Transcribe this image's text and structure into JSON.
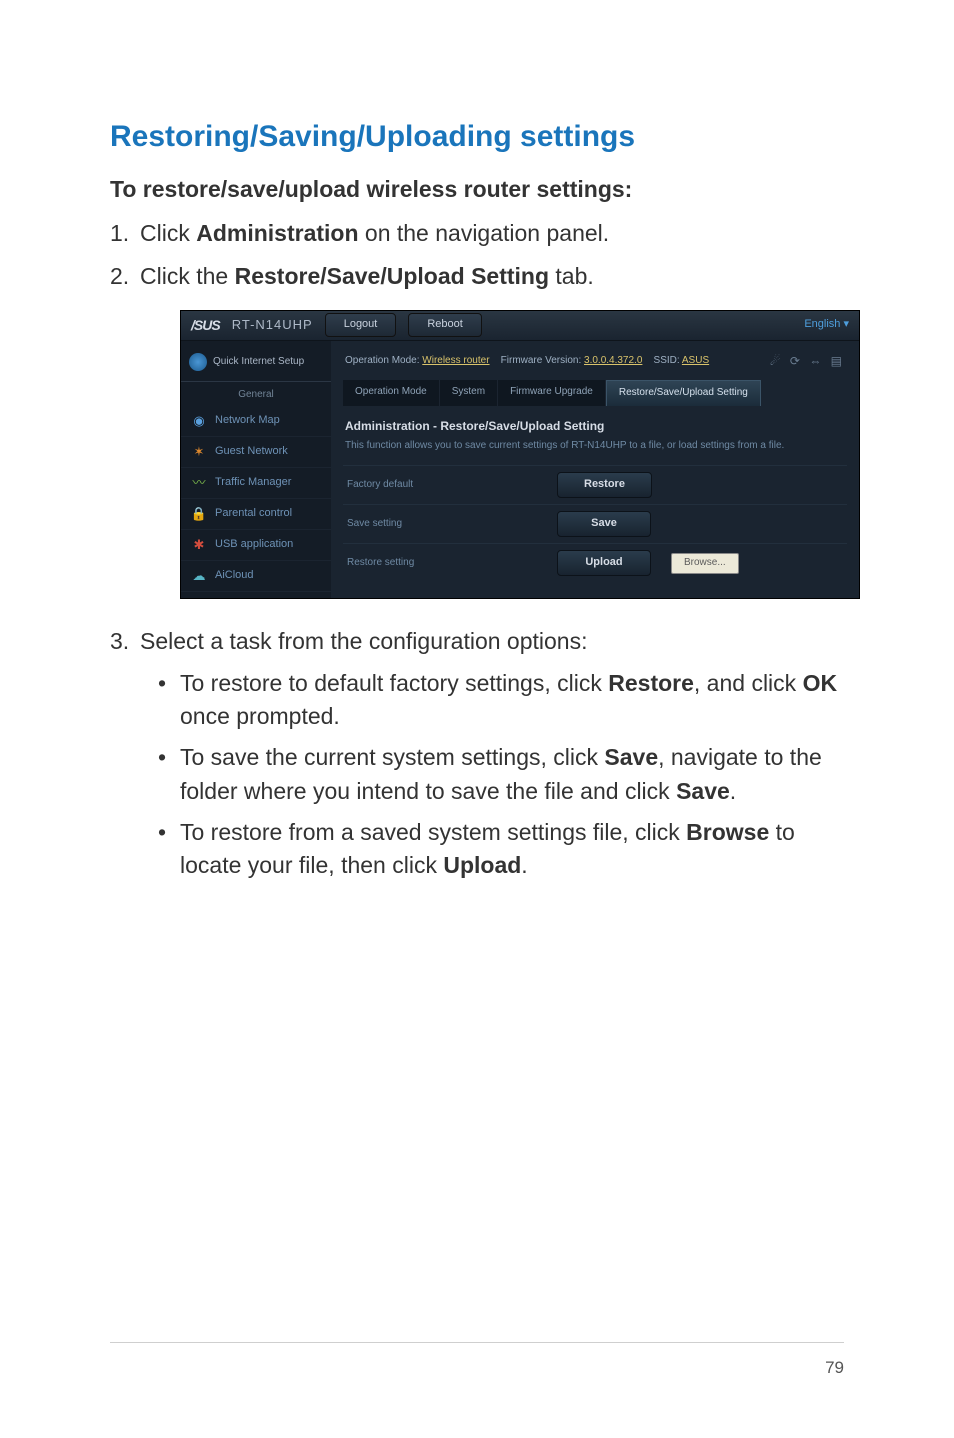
{
  "heading": "Restoring/Saving/Uploading settings",
  "subheading": "To restore/save/upload wireless router settings:",
  "steps": {
    "s1_pre": "Click ",
    "s1_bold": "Administration",
    "s1_post": " on the navigation panel.",
    "s2_pre": "Click the ",
    "s2_bold": "Restore/Save/Upload Setting",
    "s2_post": " tab.",
    "s3": "Select a task from the configuration options:"
  },
  "bullets": {
    "b1_pre": "To restore to default factory settings, click ",
    "b1_bold1": "Restore",
    "b1_mid": ", and click ",
    "b1_bold2": "OK",
    "b1_post": " once prompted.",
    "b2_pre": "To save the current system settings, click ",
    "b2_bold1": "Save",
    "b2_mid": ", navigate to the folder where you intend to save the file and click ",
    "b2_bold2": "Save",
    "b2_post": ".",
    "b3_pre": "To restore from a saved system settings file, click ",
    "b3_bold1": "Browse",
    "b3_mid": " to locate your file, then click ",
    "b3_bold2": "Upload",
    "b3_post": "."
  },
  "screenshot": {
    "logo": "/SUS",
    "model": "RT-N14UHP",
    "btn_logout": "Logout",
    "btn_reboot": "Reboot",
    "language": "English",
    "opmode_label": "Operation Mode:",
    "opmode_value": "Wireless router",
    "fw_label": "Firmware Version:",
    "fw_value": "3.0.0.4.372.0",
    "ssid_label": "SSID:",
    "ssid_value": "ASUS",
    "quick_setup": "Quick Internet Setup",
    "section_general": "General",
    "nav": {
      "network_map": "Network Map",
      "guest_network": "Guest Network",
      "traffic_manager": "Traffic Manager",
      "parental_control": "Parental control",
      "usb_application": "USB application",
      "aicloud": "AiCloud"
    },
    "tabs": {
      "operation_mode": "Operation Mode",
      "system": "System",
      "firmware_upgrade": "Firmware Upgrade",
      "restore_save_upload": "Restore/Save/Upload Setting"
    },
    "panel_title": "Administration - Restore/Save/Upload Setting",
    "panel_desc": "This function allows you to save current settings of RT-N14UHP to a file, or load settings from a file.",
    "rows": {
      "factory_default": "Factory default",
      "restore_btn": "Restore",
      "save_setting": "Save setting",
      "save_btn": "Save",
      "restore_setting": "Restore setting",
      "upload_btn": "Upload",
      "browse_btn": "Browse..."
    }
  },
  "page_number": "79"
}
